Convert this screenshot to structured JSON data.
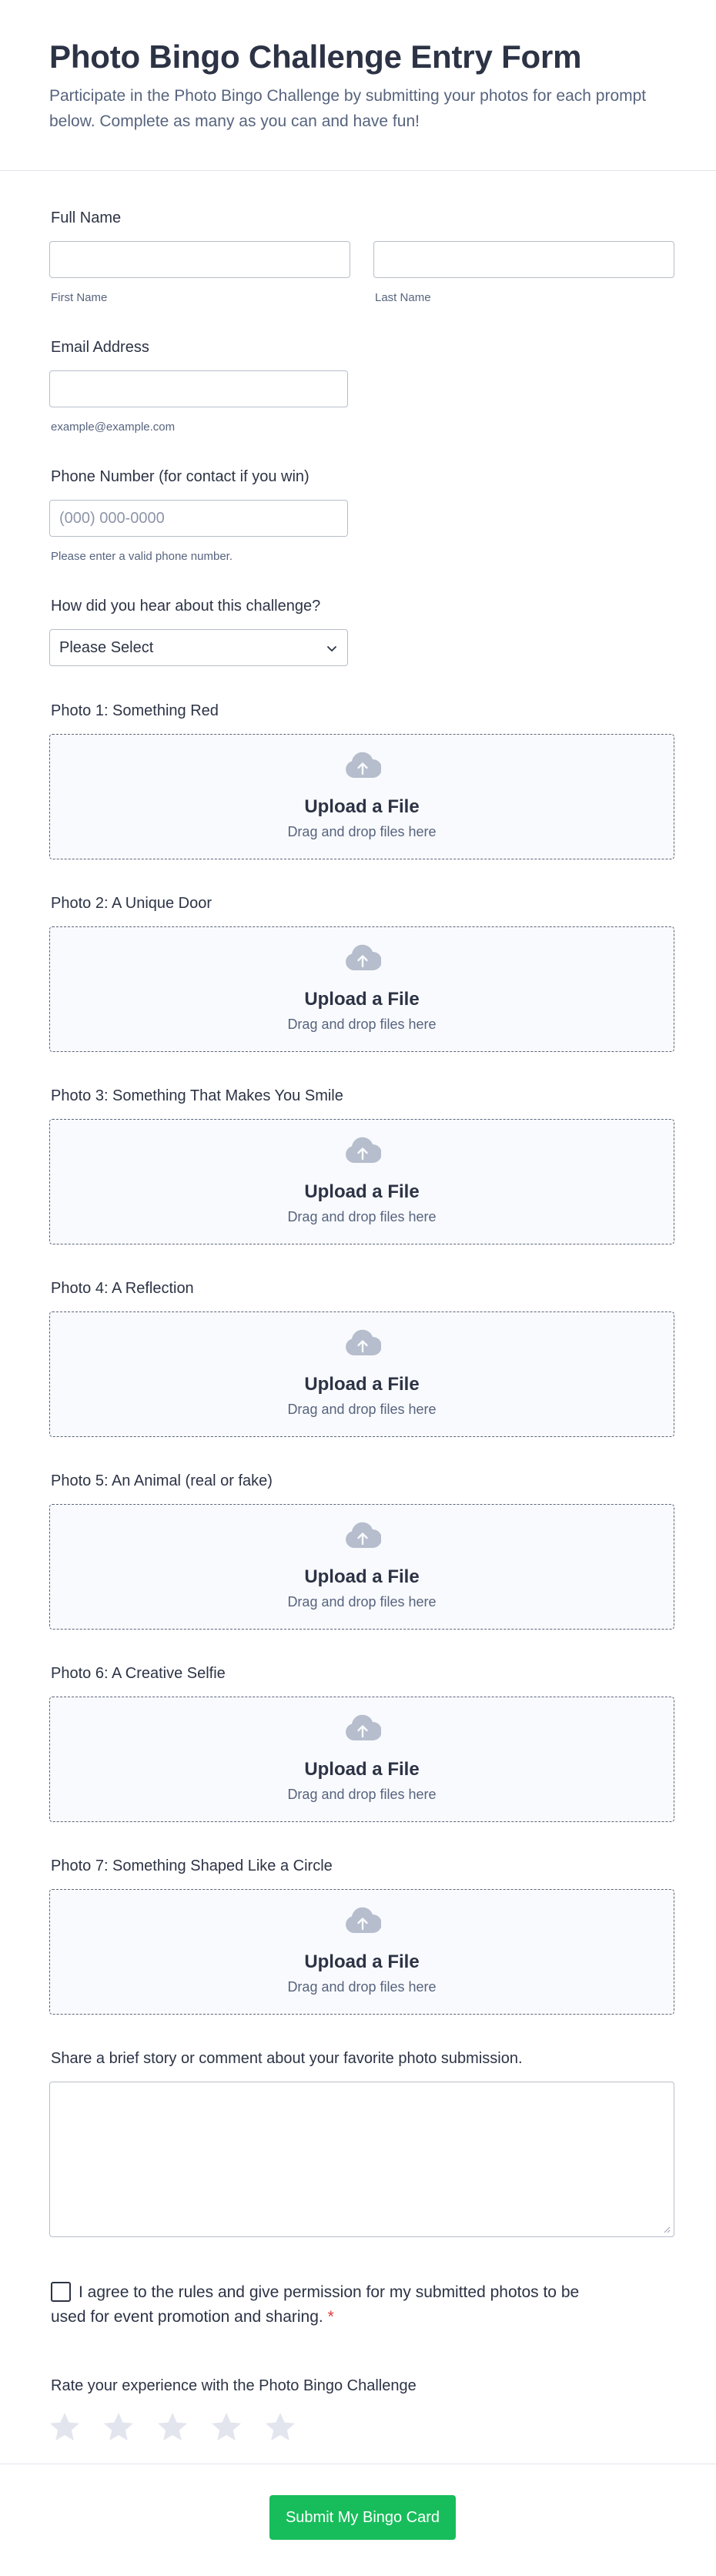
{
  "header": {
    "title": "Photo Bingo Challenge Entry Form",
    "subtitle": "Participate in the Photo Bingo Challenge by submitting your photos for each prompt below. Complete as many as you can and have fun!"
  },
  "full_name": {
    "label": "Full Name",
    "first_sublabel": "First Name",
    "last_sublabel": "Last Name"
  },
  "email": {
    "label": "Email Address",
    "sublabel": "example@example.com"
  },
  "phone": {
    "label": "Phone Number (for contact if you win)",
    "placeholder": "(000) 000-0000",
    "sublabel": "Please enter a valid phone number."
  },
  "referral": {
    "label": "How did you hear about this challenge?",
    "selected": "Please Select"
  },
  "uploads": [
    {
      "label": "Photo 1: Something Red",
      "title": "Upload a File",
      "hint": "Drag and drop files here"
    },
    {
      "label": "Photo 2: A Unique Door",
      "title": "Upload a File",
      "hint": "Drag and drop files here"
    },
    {
      "label": "Photo 3: Something That Makes You Smile",
      "title": "Upload a File",
      "hint": "Drag and drop files here"
    },
    {
      "label": "Photo 4: A Reflection",
      "title": "Upload a File",
      "hint": "Drag and drop files here"
    },
    {
      "label": "Photo 5: An Animal (real or fake)",
      "title": "Upload a File",
      "hint": "Drag and drop files here"
    },
    {
      "label": "Photo 6: A Creative Selfie",
      "title": "Upload a File",
      "hint": "Drag and drop files here"
    },
    {
      "label": "Photo 7: Something Shaped Like a Circle",
      "title": "Upload a File",
      "hint": "Drag and drop files here"
    }
  ],
  "story": {
    "label": "Share a brief story or comment about your favorite photo submission."
  },
  "agreement": {
    "text": "I agree to the rules and give permission for my submitted photos to be used for event promotion and sharing.",
    "required_mark": "*",
    "checked": false
  },
  "rating": {
    "label": "Rate your experience with the Photo Bingo Challenge",
    "max": 5,
    "value": 0
  },
  "submit": {
    "label": "Submit My Bingo Card"
  },
  "colors": {
    "accent": "#18bd5b",
    "required": "#e13b3b",
    "text": "#2c3345",
    "muted": "#57647e",
    "star_empty": "#e3e5ee"
  }
}
